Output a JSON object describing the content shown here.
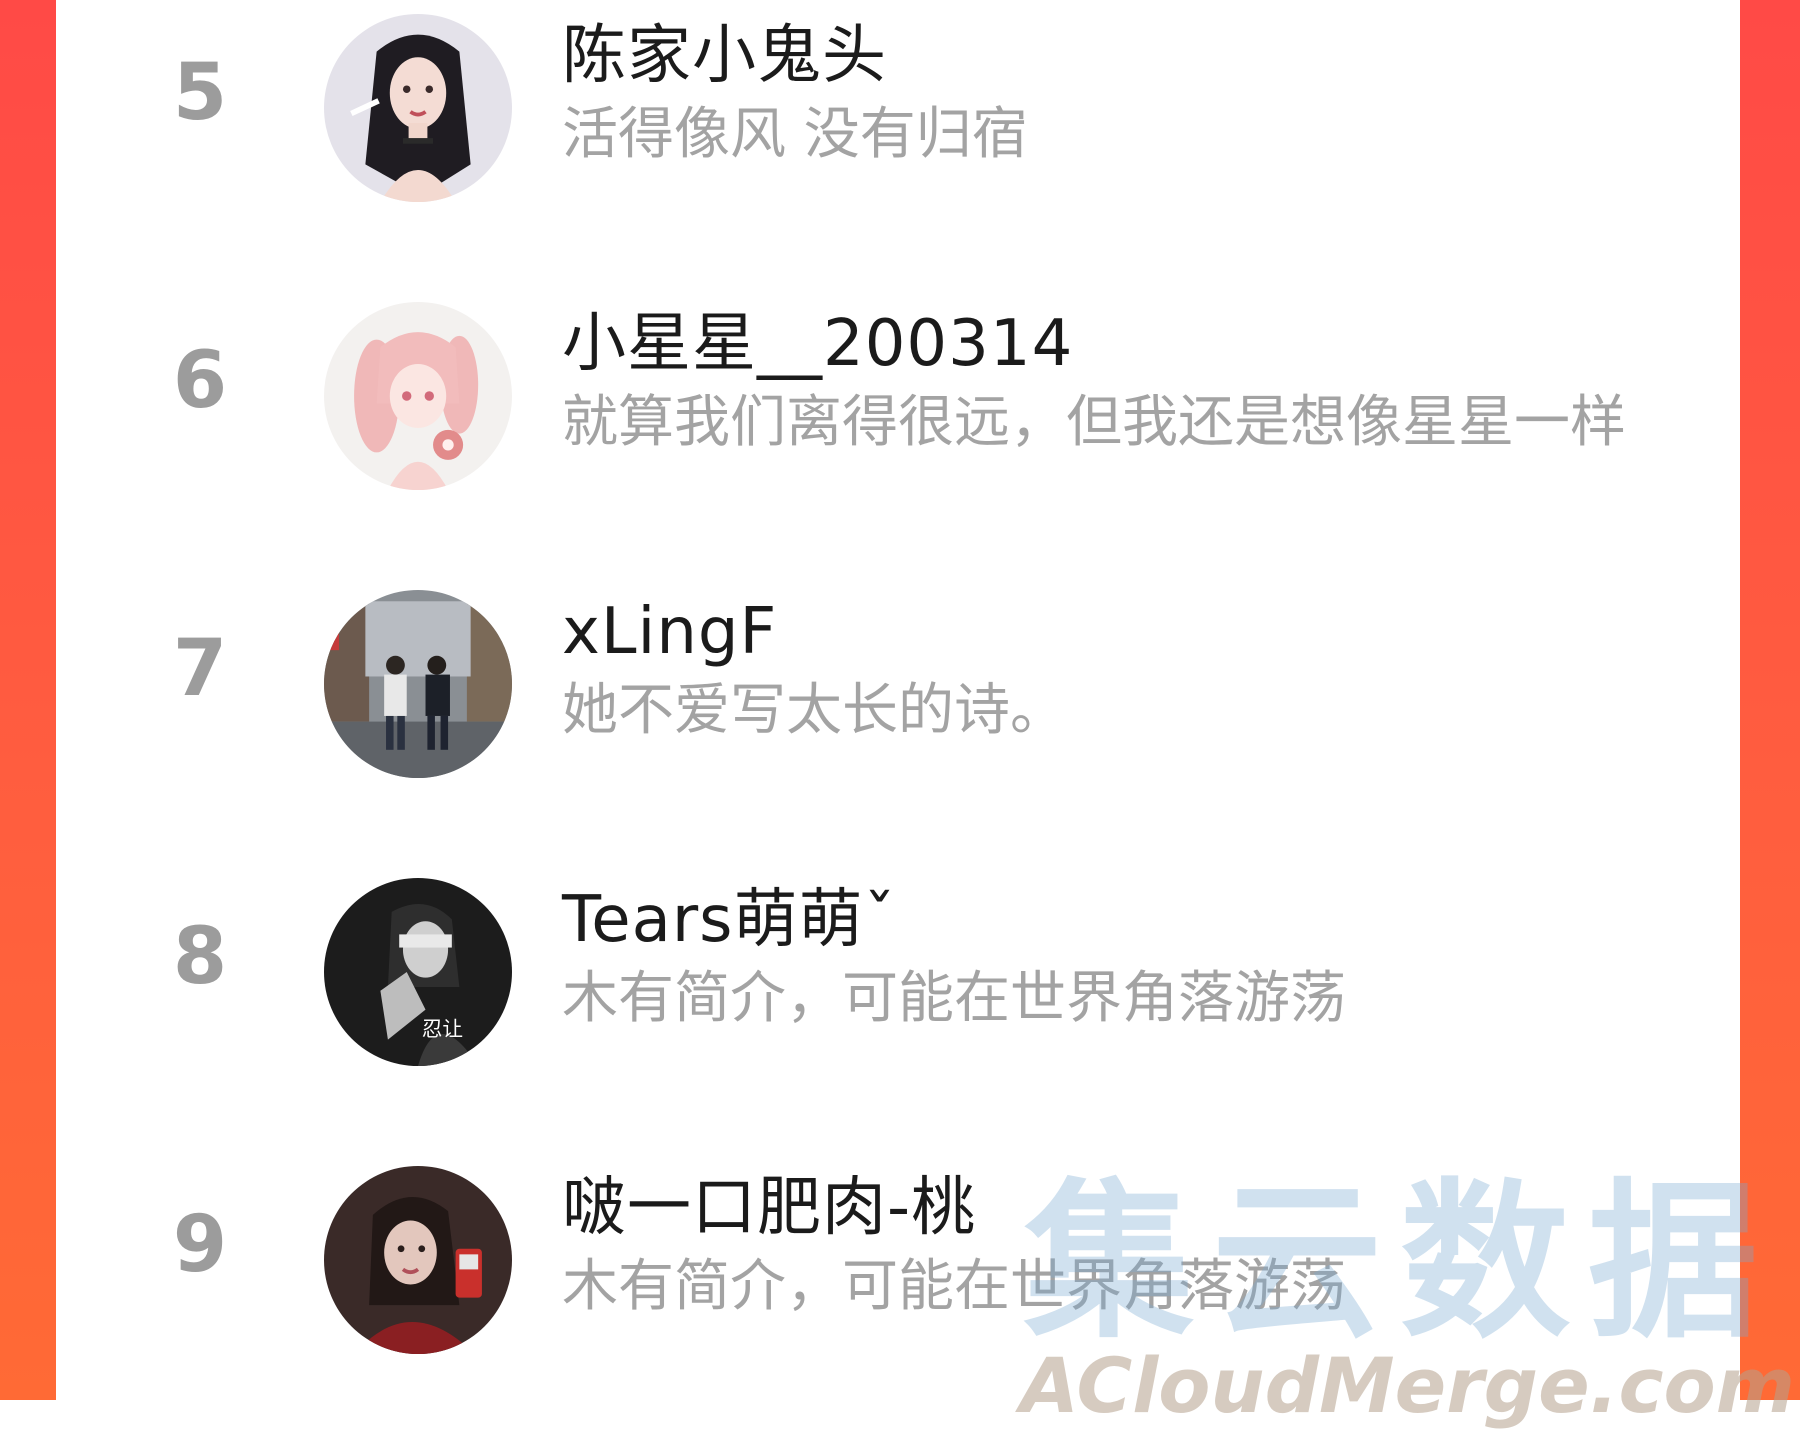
{
  "ranking": {
    "items": [
      {
        "rank": "5",
        "name": "陈家小鬼头",
        "bio": "活得像风 没有归宿",
        "avatar_icon": "avatar-girl-dark-hair-icon"
      },
      {
        "rank": "6",
        "name": "小星星__200314",
        "bio": "就算我们离得很远，但我还是想像星星一样",
        "avatar_icon": "avatar-anime-pink-hair-icon"
      },
      {
        "rank": "7",
        "name": "xLingF",
        "bio": "她不爱写太长的诗。",
        "avatar_icon": "avatar-couple-street-icon"
      },
      {
        "rank": "8",
        "name": "Tears萌萌ˇ",
        "bio": "木有简介，可能在世界角落游荡",
        "avatar_icon": "avatar-blindfold-girl-icon",
        "avatar_text": "忍让"
      },
      {
        "rank": "9",
        "name": "啵一口肥肉-桃",
        "bio": "木有简介，可能在世界角落游荡",
        "avatar_icon": "avatar-girl-selfie-icon"
      }
    ]
  },
  "watermark": {
    "cn": "集云数据",
    "en": "ACloudMerge.com"
  },
  "colors": {
    "frame": "#ff4a46",
    "rank": "#9c9c9c",
    "name": "#1b1b1b",
    "bio": "#a3a3a3"
  }
}
